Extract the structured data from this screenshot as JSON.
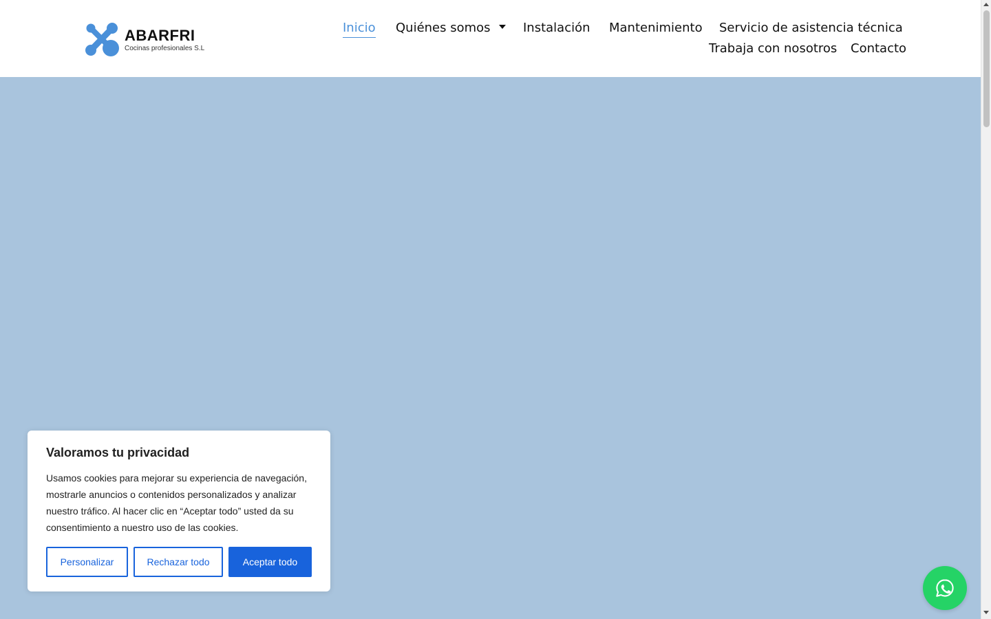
{
  "brand": {
    "name": "ABARFRI",
    "tagline": "Cocinas profesionales S.L",
    "logo_color": "#4a90d9"
  },
  "nav": {
    "items": [
      {
        "label": "Inicio",
        "active": true
      },
      {
        "label": "Quiénes somos",
        "has_dropdown": true
      },
      {
        "label": "Instalación"
      },
      {
        "label": "Mantenimiento"
      },
      {
        "label": "Servicio de asistencia técnica"
      },
      {
        "label": "Trabaja con nosotros"
      },
      {
        "label": "Contacto"
      }
    ],
    "active_color": "#4a90d9"
  },
  "hero": {
    "background_color": "#a9c4dd"
  },
  "cookie_banner": {
    "title": "Valoramos tu privacidad",
    "body": "Usamos cookies para mejorar su experiencia de navegación, mostrarle anuncios o contenidos personalizados y analizar nuestro tráfico. Al hacer clic en “Aceptar todo” usted da su consentimiento a nuestro uso de las cookies.",
    "buttons": {
      "customize": "Personalizar",
      "reject": "Rechazar todo",
      "accept": "Aceptar todo"
    },
    "accent_color": "#1863dc"
  },
  "whatsapp": {
    "icon": "whatsapp-icon",
    "color": "#25d366"
  }
}
